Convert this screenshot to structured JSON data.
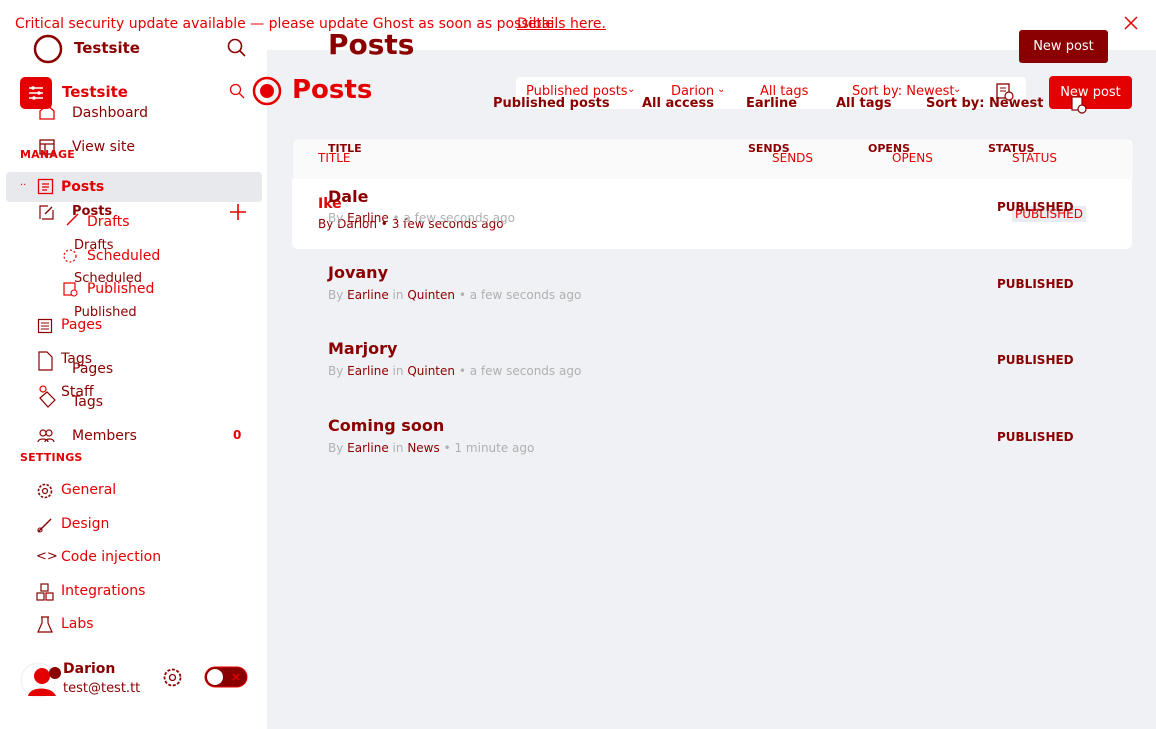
{
  "banner": {
    "text": "Critical security update available — please update Ghost as soon as possible.",
    "link": "Details here."
  },
  "site": {
    "name": "Testsite",
    "name_ghost": "Testsite"
  },
  "sidebar": {
    "dashboard": "Dashboard",
    "view_site": "View site",
    "manage_label": "MANAGE",
    "posts": "Posts",
    "posts_ghost": "Posts",
    "drafts": "Drafts",
    "drafts_ghost": "Drafts",
    "scheduled": "Scheduled",
    "scheduled_ghost": "Scheduled",
    "published": "Published",
    "published_ghost": "Published",
    "pages": "Pages",
    "pages_ghost": "Pages",
    "tags": "Tags",
    "tags_ghost": "Tags",
    "staff": "Staff",
    "members": "Members",
    "members_count": "0",
    "settings_label": "SETTINGS",
    "general": "General",
    "design": "Design",
    "code_injection": "Code injection",
    "integrations": "Integrations",
    "labs": "Labs"
  },
  "user": {
    "name": "Darion",
    "email": "test@test.tt"
  },
  "header": {
    "title": "Posts",
    "title_ghost": "Posts",
    "new_post": "New post",
    "new_post_ghost": "New post"
  },
  "filters": {
    "type": "Published posts",
    "author": "Darion",
    "tags": "All tags",
    "sort": "Sort by: Newest",
    "type2": "Published posts",
    "access2": "All access",
    "author2": "Earline",
    "tags2": "All tags",
    "sort2": "Sort by: Newest"
  },
  "table": {
    "col_title": "TITLE",
    "col_sends": "SENDS",
    "col_opens": "OPENS",
    "col_status": "STATUS",
    "col_title_ghost": "TITLE",
    "col_sends_ghost": "SENDS",
    "col_opens_ghost": "OPENS",
    "col_status_ghost": "STATUS",
    "ghost_row": {
      "title": "Ike",
      "by": "By",
      "author": "Darion",
      "time": "3 few seconds ago",
      "status": "PUBLISHED"
    },
    "rows": [
      {
        "title": "Dale",
        "by": "By",
        "author": "Earline",
        "in": "",
        "tag": "",
        "time": "a few seconds ago",
        "status": "PUBLISHED"
      },
      {
        "title": "Jovany",
        "by": "By",
        "author": "Earline",
        "in": "in",
        "tag": "Quinten",
        "time": "a few seconds ago",
        "status": "PUBLISHED"
      },
      {
        "title": "Marjory",
        "by": "By",
        "author": "Earline",
        "in": "in",
        "tag": "Quinten",
        "time": "a few seconds ago",
        "status": "PUBLISHED"
      },
      {
        "title": "Coming soon",
        "by": "By",
        "author": "Earline",
        "in": "in",
        "tag": "News",
        "time": "1 minute ago",
        "status": "PUBLISHED"
      }
    ]
  },
  "colors": {
    "accent": "#e40000",
    "dark": "#8a0000",
    "bg": "#f0f1f4"
  }
}
